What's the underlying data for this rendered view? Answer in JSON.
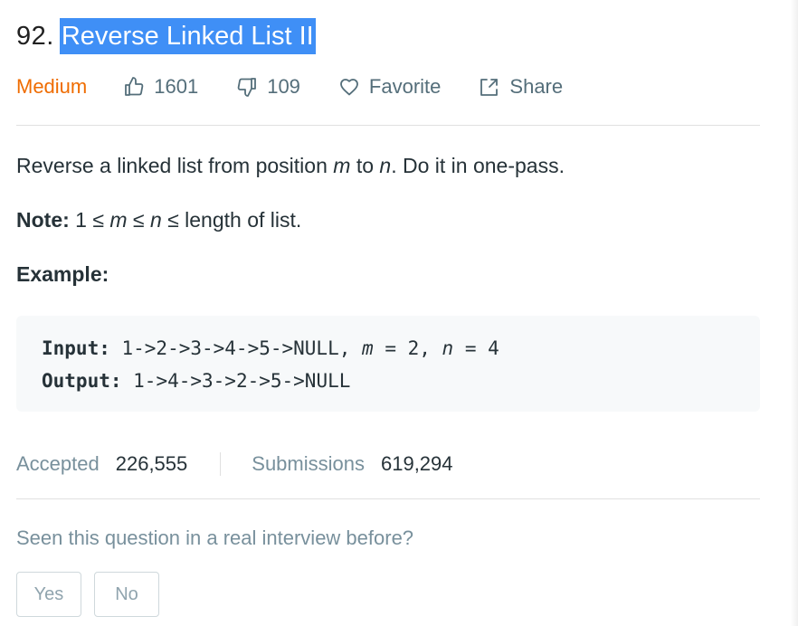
{
  "problem": {
    "number": "92.",
    "title": "Reverse Linked List II"
  },
  "meta": {
    "difficulty": "Medium",
    "likes": "1601",
    "dislikes": "109",
    "favorite_label": "Favorite",
    "share_label": "Share"
  },
  "description": {
    "line1_pre": "Reverse a linked list from position ",
    "line1_m": "m",
    "line1_mid": " to ",
    "line1_n": "n",
    "line1_post": ". Do it in one-pass.",
    "note_label": "Note:",
    "note_pre": " 1 ≤ ",
    "note_m": "m",
    "note_mid1": " ≤ ",
    "note_n": "n",
    "note_post": " ≤ length of list.",
    "example_label": "Example:"
  },
  "example": {
    "input_label": "Input:",
    "input_pre": " 1->2->3->4->5->NULL, ",
    "input_m": "m",
    "input_mid": " = 2, ",
    "input_n": "n",
    "input_post": " = 4",
    "output_label": "Output:",
    "output_value": " 1->4->3->2->5->NULL"
  },
  "stats": {
    "accepted_label": "Accepted",
    "accepted_value": "226,555",
    "submissions_label": "Submissions",
    "submissions_value": "619,294"
  },
  "interview": {
    "question": "Seen this question in a real interview before?",
    "yes_label": "Yes",
    "no_label": "No"
  },
  "colors": {
    "difficulty_medium": "#ef6c00",
    "title_highlight": "#3f8ff6",
    "muted_text": "#546e7a",
    "code_background": "#f7f9fa"
  },
  "icons": {
    "like": "thumbs-up-icon",
    "dislike": "thumbs-down-icon",
    "favorite": "heart-icon",
    "share": "share-icon"
  }
}
